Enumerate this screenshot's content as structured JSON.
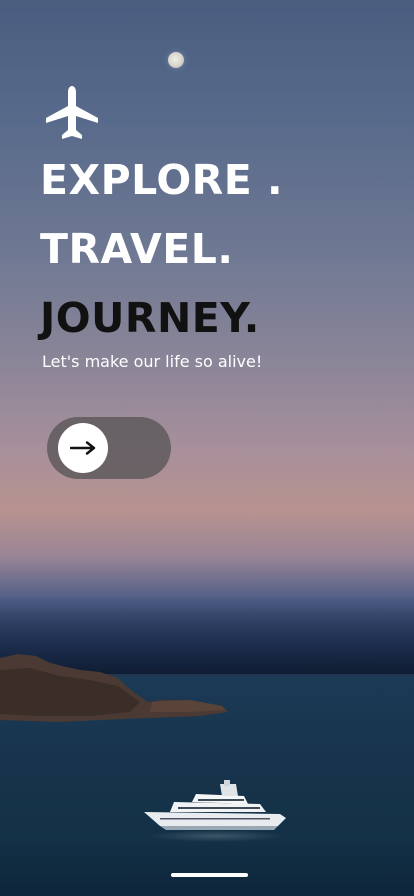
{
  "hero": {
    "line_1": "EXPLORE .",
    "line_2": "TRAVEL.",
    "line_3": "JOURNEY.",
    "tagline": "Let's make our life so alive!"
  },
  "icons": {
    "top": "airplane-icon",
    "slider": "arrow-right-icon"
  },
  "background": {
    "description_colors": {
      "sky_top": "#4a5d80",
      "sky_glow": "#b8938f",
      "sea": "#153149"
    }
  },
  "colors": {
    "text_light": "#ffffff",
    "text_dark": "#111111",
    "slider_track": "#5c585a",
    "slider_knob": "#ffffff"
  }
}
